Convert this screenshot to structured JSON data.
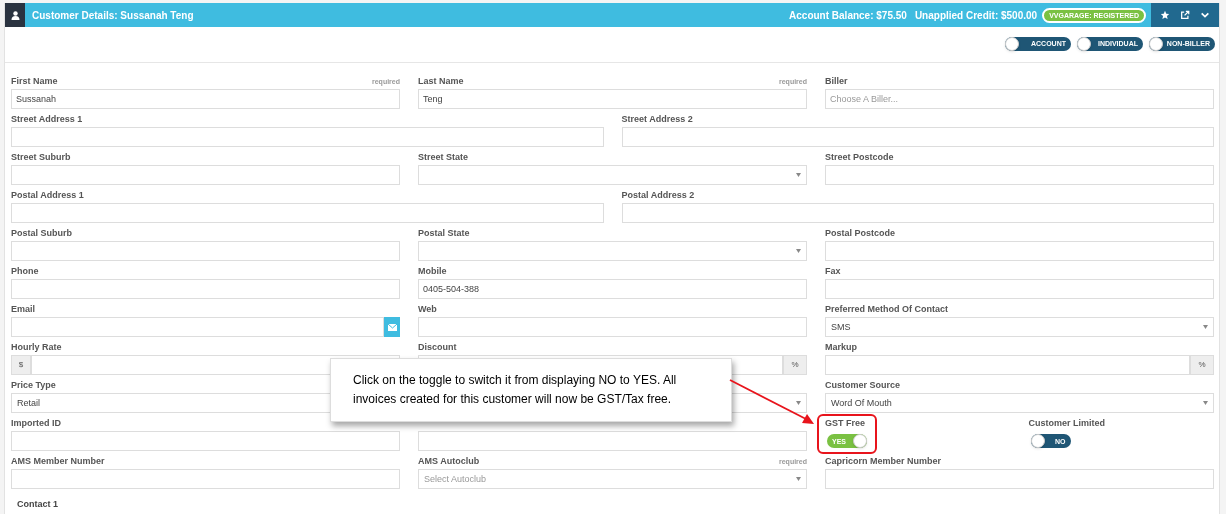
{
  "header": {
    "title": "Customer Details: Sussanah Teng",
    "balance": "Account Balance: $75.50",
    "credit": "Unapplied Credit: $500.00",
    "badge": "VVGARAGE: REGISTERED"
  },
  "type_toggles": [
    {
      "text": "ACCOUNT",
      "on": false
    },
    {
      "text": "INDIVIDUAL",
      "on": false
    },
    {
      "text": "NON-BILLER",
      "on": false
    }
  ],
  "rows": [
    {
      "fields": [
        {
          "kind": "text",
          "label": "First Name",
          "hint": "required",
          "value": "Sussanah"
        },
        {
          "kind": "text",
          "label": "Last Name",
          "hint": "required",
          "value": "Teng"
        },
        {
          "kind": "text",
          "label": "Biller",
          "placeholder": "Choose A Biller..."
        }
      ]
    },
    {
      "fields": [
        {
          "kind": "text",
          "label": "Street Address 1"
        },
        {
          "kind": "text",
          "label": "Street Address 2"
        }
      ]
    },
    {
      "fields": [
        {
          "kind": "text",
          "label": "Street Suburb"
        },
        {
          "kind": "select",
          "label": "Street State"
        },
        {
          "kind": "text",
          "label": "Street Postcode"
        }
      ]
    },
    {
      "fields": [
        {
          "kind": "text",
          "label": "Postal Address 1"
        },
        {
          "kind": "text",
          "label": "Postal Address 2"
        }
      ]
    },
    {
      "fields": [
        {
          "kind": "text",
          "label": "Postal Suburb"
        },
        {
          "kind": "select",
          "label": "Postal State"
        },
        {
          "kind": "text",
          "label": "Postal Postcode"
        }
      ]
    },
    {
      "fields": [
        {
          "kind": "text",
          "label": "Phone"
        },
        {
          "kind": "text",
          "label": "Mobile",
          "value": "0405-504-388"
        },
        {
          "kind": "text",
          "label": "Fax"
        }
      ]
    },
    {
      "fields": [
        {
          "kind": "email",
          "label": "Email"
        },
        {
          "kind": "text",
          "label": "Web"
        },
        {
          "kind": "select",
          "label": "Preferred Method Of Contact",
          "value": "SMS"
        }
      ]
    },
    {
      "fields": [
        {
          "kind": "addon",
          "label": "Hourly Rate",
          "prefix": "$"
        },
        {
          "kind": "addon",
          "label": "Discount",
          "suffix": "%"
        },
        {
          "kind": "addon",
          "label": "Markup",
          "suffix": "%"
        }
      ]
    },
    {
      "fields": [
        {
          "kind": "select",
          "label": "Price Type",
          "value": "Retail"
        },
        {
          "kind": "select"
        },
        {
          "kind": "select",
          "label": "Customer Source",
          "value": "Word Of Mouth"
        }
      ]
    },
    {
      "fields": [
        {
          "kind": "text",
          "label": "Imported ID"
        },
        {
          "kind": "text"
        },
        {
          "kind": "toggle_pair",
          "toggles": [
            {
              "label": "GST Free",
              "on": true,
              "text": "YES",
              "highlighted": true
            },
            {
              "label": "Customer Limited",
              "on": false,
              "text": "NO",
              "highlighted": false
            }
          ]
        }
      ]
    },
    {
      "fields": [
        {
          "kind": "text",
          "label": "AMS Member Number"
        },
        {
          "kind": "select",
          "label": "AMS Autoclub",
          "hint": "required",
          "placeholder": "Select Autoclub"
        },
        {
          "kind": "text",
          "label": "Capricorn Member Number"
        }
      ]
    }
  ],
  "section_heading": "Contact 1",
  "callout": "Click on the toggle to switch it from displaying NO to YES. All invoices created for this customer will now be GST/Tax free."
}
